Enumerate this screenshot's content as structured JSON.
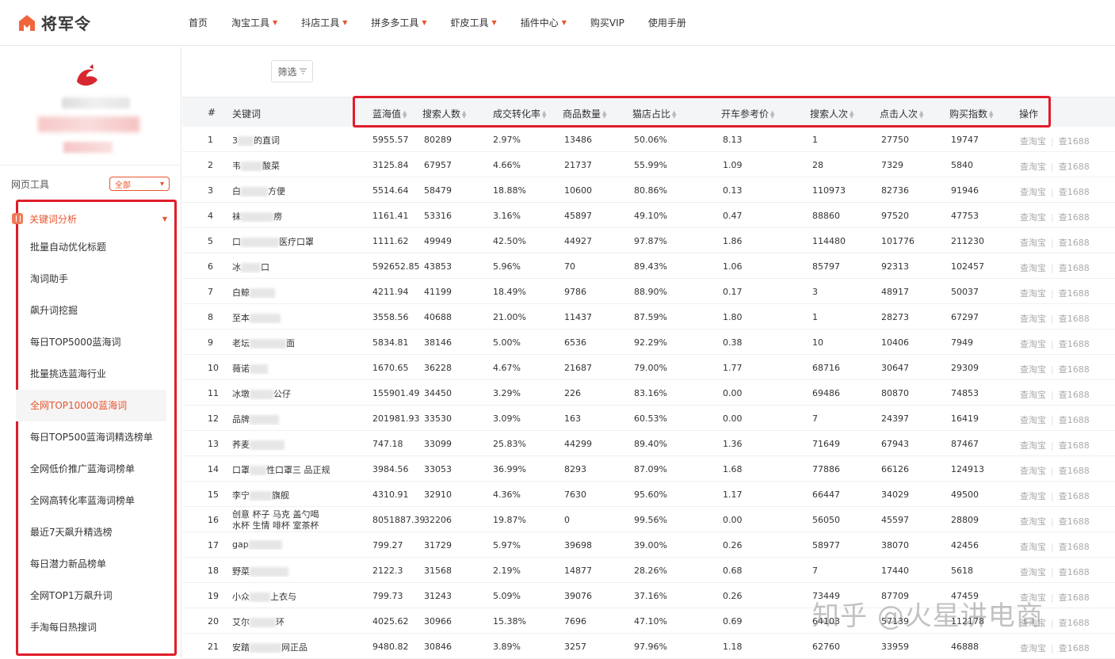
{
  "brand": {
    "name": "将军令",
    "accent": "#e8542f",
    "highlight": "#e01d2a"
  },
  "nav": [
    {
      "label": "首页",
      "caret": false
    },
    {
      "label": "淘宝工具",
      "caret": true
    },
    {
      "label": "抖店工具",
      "caret": true
    },
    {
      "label": "拼多多工具",
      "caret": true
    },
    {
      "label": "虾皮工具",
      "caret": true
    },
    {
      "label": "插件中心",
      "caret": true
    },
    {
      "label": "购买VIP",
      "caret": false
    },
    {
      "label": "使用手册",
      "caret": false
    }
  ],
  "sidebar": {
    "tool_label": "网页工具",
    "tool_select": "全部",
    "section": "关键词分析",
    "items": [
      "批量自动优化标题",
      "淘词助手",
      "飙升词挖掘",
      "每日TOP5000蓝海词",
      "批量挑选蓝海行业",
      "全网TOP10000蓝海词",
      "每日TOP500蓝海词精选榜单",
      "全网低价推广蓝海词榜单",
      "全网高转化率蓝海词榜单",
      "最近7天飙升精选榜",
      "每日潜力新品榜单",
      "全网TOP1万飙升词",
      "手淘每日热搜词"
    ],
    "active_index": 5
  },
  "toolbar": {
    "filter_label": "筛选"
  },
  "table": {
    "headers": {
      "rank": "#",
      "keyword": "关键词",
      "blue_value": "蓝海值",
      "searchers": "搜索人数",
      "conversion": "成交转化率",
      "products": "商品数量",
      "tmall_ratio": "猫店占比",
      "ref_price": "开车参考价",
      "search_count": "搜索人次",
      "click_count": "点击人次",
      "buy_index": "购买指数",
      "action": "操作"
    },
    "action_labels": {
      "taobao": "查淘宝",
      "ali": "查1688"
    },
    "rows": [
      {
        "rank": "1",
        "kw_a": "3",
        "kw_b": "的直",
        "kw_c": "词",
        "blue": "5955.57",
        "searchers": "80289",
        "conv": "2.97%",
        "products": "13486",
        "tmall": "50.06%",
        "price": "8.13",
        "search": "1",
        "click": "27750",
        "buy": "19747"
      },
      {
        "rank": "2",
        "kw_a": "韦",
        "kw_b": "",
        "kw_c": "酸菜",
        "blue": "3125.84",
        "searchers": "67957",
        "conv": "4.66%",
        "products": "21737",
        "tmall": "55.99%",
        "price": "1.09",
        "search": "28",
        "click": "7329",
        "buy": "5840"
      },
      {
        "rank": "3",
        "kw_a": "白",
        "kw_b": "",
        "kw_c": "方便",
        "blue": "5514.64",
        "searchers": "58479",
        "conv": "18.88%",
        "products": "10600",
        "tmall": "80.86%",
        "price": "0.13",
        "search": "110973",
        "click": "82736",
        "buy": "91946"
      },
      {
        "rank": "4",
        "kw_a": "袜",
        "kw_b": "",
        "kw_c": "痨",
        "blue": "1161.41",
        "searchers": "53316",
        "conv": "3.16%",
        "products": "45897",
        "tmall": "49.10%",
        "price": "0.47",
        "search": "88860",
        "click": "97520",
        "buy": "47753"
      },
      {
        "rank": "5",
        "kw_a": "口",
        "kw_b": "",
        "kw_c": "医疗口罩",
        "blue": "1111.62",
        "searchers": "49949",
        "conv": "42.50%",
        "products": "44927",
        "tmall": "97.87%",
        "price": "1.86",
        "search": "114480",
        "click": "101776",
        "buy": "211230"
      },
      {
        "rank": "6",
        "kw_a": "冰",
        "kw_b": "",
        "kw_c": "口",
        "blue": "592652.85",
        "searchers": "43853",
        "conv": "5.96%",
        "products": "70",
        "tmall": "89.43%",
        "price": "1.06",
        "search": "85797",
        "click": "92313",
        "buy": "102457"
      },
      {
        "rank": "7",
        "kw_a": "白鲸",
        "kw_b": "",
        "kw_c": "",
        "blue": "4211.94",
        "searchers": "41199",
        "conv": "18.49%",
        "products": "9786",
        "tmall": "88.90%",
        "price": "0.17",
        "search": "3",
        "click": "48917",
        "buy": "50037"
      },
      {
        "rank": "8",
        "kw_a": "至本",
        "kw_b": "",
        "kw_c": "",
        "blue": "3558.56",
        "searchers": "40688",
        "conv": "21.00%",
        "products": "11437",
        "tmall": "87.59%",
        "price": "1.80",
        "search": "1",
        "click": "28273",
        "buy": "67297"
      },
      {
        "rank": "9",
        "kw_a": "老坛",
        "kw_b": "",
        "kw_c": "面",
        "blue": "5834.81",
        "searchers": "38146",
        "conv": "5.00%",
        "products": "6536",
        "tmall": "92.29%",
        "price": "0.38",
        "search": "10",
        "click": "10406",
        "buy": "7949"
      },
      {
        "rank": "10",
        "kw_a": "薇诺",
        "kw_b": "",
        "kw_c": "",
        "blue": "1670.65",
        "searchers": "36228",
        "conv": "4.67%",
        "products": "21687",
        "tmall": "79.00%",
        "price": "1.77",
        "search": "68716",
        "click": "30647",
        "buy": "29309"
      },
      {
        "rank": "11",
        "kw_a": "冰墩",
        "kw_b": "",
        "kw_c": "公仔",
        "blue": "155901.49",
        "searchers": "34450",
        "conv": "3.29%",
        "products": "226",
        "tmall": "83.16%",
        "price": "0.00",
        "search": "69486",
        "click": "80870",
        "buy": "74853"
      },
      {
        "rank": "12",
        "kw_a": "品牌",
        "kw_b": "",
        "kw_c": "",
        "blue": "201981.93",
        "searchers": "33530",
        "conv": "3.09%",
        "products": "163",
        "tmall": "60.53%",
        "price": "0.00",
        "search": "7",
        "click": "24397",
        "buy": "16419"
      },
      {
        "rank": "13",
        "kw_a": "荞麦",
        "kw_b": "",
        "kw_c": "",
        "blue": "747.18",
        "searchers": "33099",
        "conv": "25.83%",
        "products": "44299",
        "tmall": "89.40%",
        "price": "1.36",
        "search": "71649",
        "click": "67943",
        "buy": "87467"
      },
      {
        "rank": "14",
        "kw_a": "口罩",
        "kw_b": "性",
        "kw_c": "口罩三 品正规",
        "blue": "3984.56",
        "searchers": "33053",
        "conv": "36.99%",
        "products": "8293",
        "tmall": "87.09%",
        "price": "1.68",
        "search": "77886",
        "click": "66126",
        "buy": "124913"
      },
      {
        "rank": "15",
        "kw_a": "李宁",
        "kw_b": "",
        "kw_c": "旗舰",
        "blue": "4310.91",
        "searchers": "32910",
        "conv": "4.36%",
        "products": "7630",
        "tmall": "95.60%",
        "price": "1.17",
        "search": "66447",
        "click": "34029",
        "buy": "49500"
      },
      {
        "rank": "16",
        "kw_two_line": true,
        "kw_line1": "创意 杯子 马克 盖勺喝",
        "kw_line2": "水杯 生情 啡杯 室茶杯",
        "blue": "8051887.39",
        "searchers": "32206",
        "conv": "19.87%",
        "products": "0",
        "tmall": "99.56%",
        "price": "0.00",
        "search": "56050",
        "click": "45597",
        "buy": "28809"
      },
      {
        "rank": "17",
        "kw_a": "gap",
        "kw_b": "",
        "kw_c": "",
        "blue": "799.27",
        "searchers": "31729",
        "conv": "5.97%",
        "products": "39698",
        "tmall": "39.00%",
        "price": "0.26",
        "search": "58977",
        "click": "38070",
        "buy": "42456"
      },
      {
        "rank": "18",
        "kw_a": "野菜",
        "kw_b": "",
        "kw_c": "",
        "blue": "2122.3",
        "searchers": "31568",
        "conv": "2.19%",
        "products": "14877",
        "tmall": "28.26%",
        "price": "0.68",
        "search": "7",
        "click": "17440",
        "buy": "5618"
      },
      {
        "rank": "19",
        "kw_a": "小众",
        "kw_b": "",
        "kw_c": "上衣与",
        "blue": "799.73",
        "searchers": "31243",
        "conv": "5.09%",
        "products": "39076",
        "tmall": "37.16%",
        "price": "0.26",
        "search": "73449",
        "click": "87709",
        "buy": "47459"
      },
      {
        "rank": "20",
        "kw_a": "艾尔",
        "kw_b": "",
        "kw_c": "环",
        "blue": "4025.62",
        "searchers": "30966",
        "conv": "15.38%",
        "products": "7696",
        "tmall": "47.10%",
        "price": "0.69",
        "search": "64103",
        "click": "57139",
        "buy": "112178"
      },
      {
        "rank": "21",
        "kw_a": "安踏",
        "kw_b": "",
        "kw_c": "网正品",
        "blue": "9480.82",
        "searchers": "30846",
        "conv": "3.89%",
        "products": "3257",
        "tmall": "97.96%",
        "price": "1.18",
        "search": "62760",
        "click": "33959",
        "buy": "46888"
      }
    ]
  },
  "watermark": "知乎 @火星讲电商"
}
